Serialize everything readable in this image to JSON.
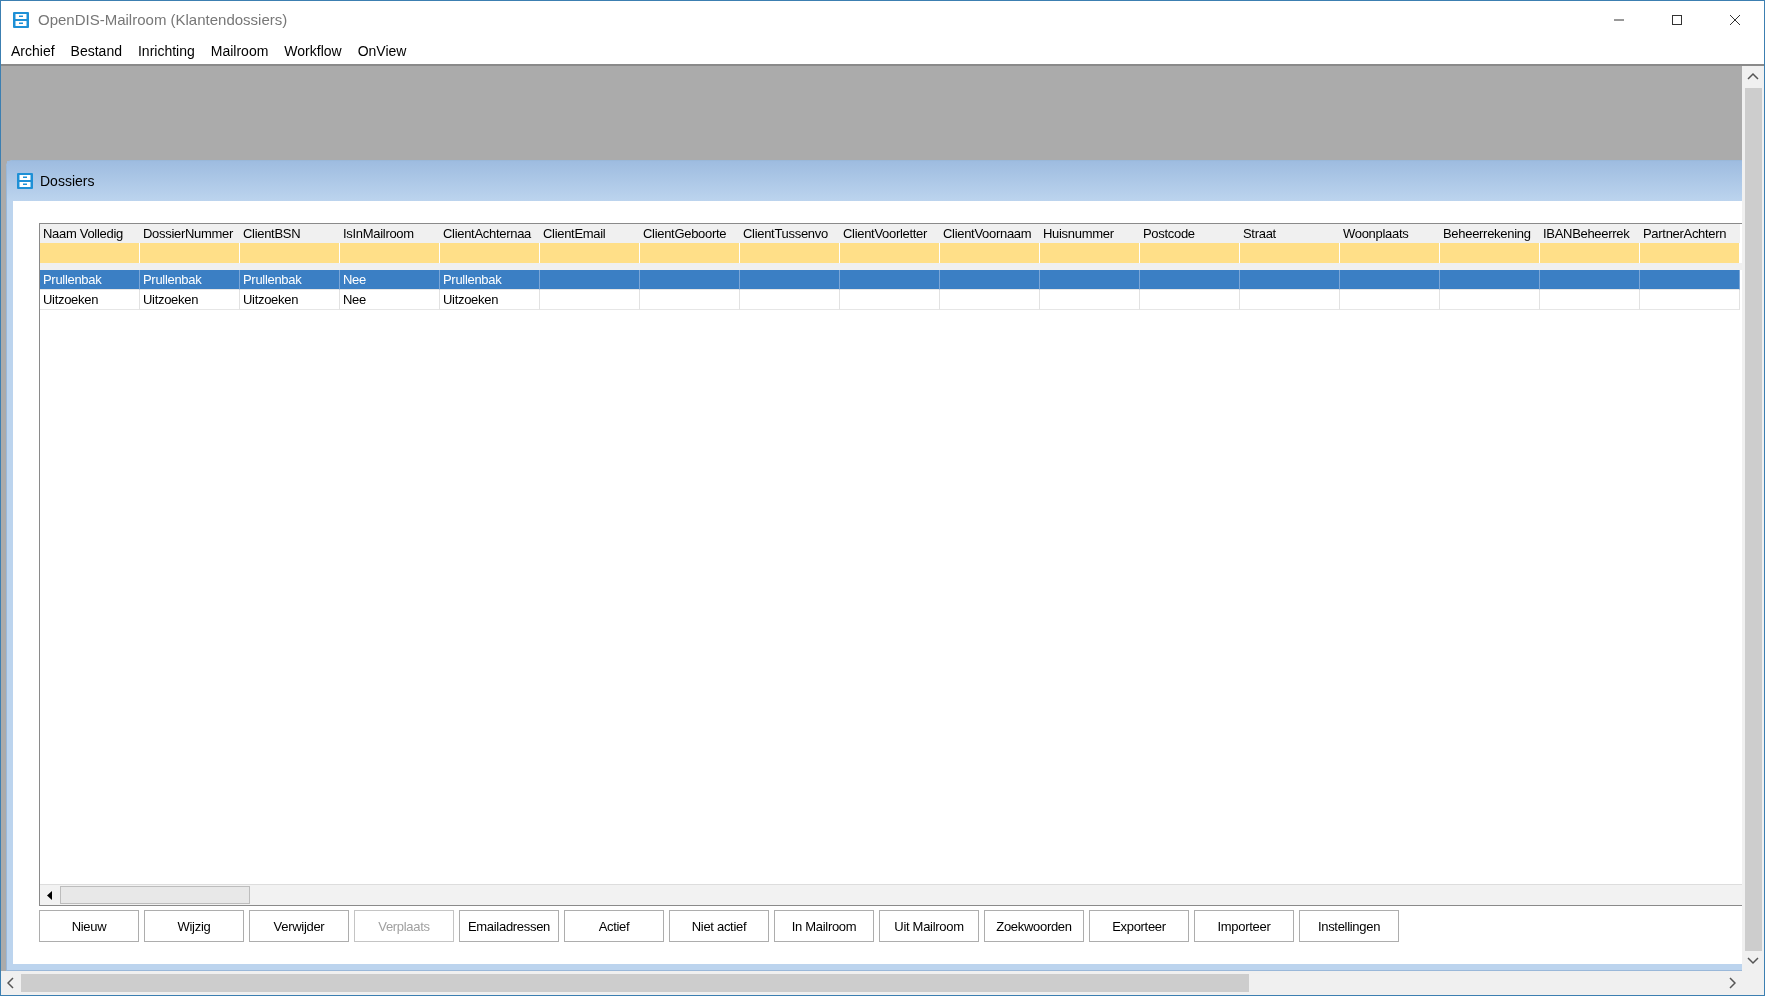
{
  "window": {
    "title": "OpenDIS-Mailroom (Klantendossiers)"
  },
  "menu": [
    "Archief",
    "Bestand",
    "Inrichting",
    "Mailroom",
    "Workflow",
    "OnView"
  ],
  "child_window": {
    "title": "Dossiers"
  },
  "table": {
    "columns": [
      "Naam Volledig",
      "DossierNummer",
      "ClientBSN",
      "IsInMailroom",
      "ClientAchternaa",
      "ClientEmail",
      "ClientGeboorte",
      "ClientTussenvo",
      "ClientVoorletter",
      "ClientVoornaam",
      "Huisnummer",
      "Postcode",
      "Straat",
      "Woonplaats",
      "Beheerrekening",
      "IBANBeheerrek",
      "PartnerAchtern"
    ],
    "rows": [
      {
        "selected": true,
        "cells": [
          "Prullenbak",
          "Prullenbak",
          "Prullenbak",
          "Nee",
          "Prullenbak"
        ]
      },
      {
        "selected": false,
        "cells": [
          "Uitzoeken",
          "Uitzoeken",
          "Uitzoeken",
          "Nee",
          "Uitzoeken"
        ]
      }
    ]
  },
  "buttons": [
    {
      "label": "Nieuw",
      "disabled": false
    },
    {
      "label": "Wijzig",
      "disabled": false
    },
    {
      "label": "Verwijder",
      "disabled": false
    },
    {
      "label": "Verplaats",
      "disabled": true
    },
    {
      "label": "Emailadressen",
      "disabled": false
    },
    {
      "label": "Actief",
      "disabled": false
    },
    {
      "label": "Niet actief",
      "disabled": false
    },
    {
      "label": "In Mailroom",
      "disabled": false
    },
    {
      "label": "Uit Mailroom",
      "disabled": false
    },
    {
      "label": "Zoekwoorden",
      "disabled": false
    },
    {
      "label": "Exporteer",
      "disabled": false
    },
    {
      "label": "Importeer",
      "disabled": false
    },
    {
      "label": "Instellingen",
      "disabled": false
    }
  ]
}
